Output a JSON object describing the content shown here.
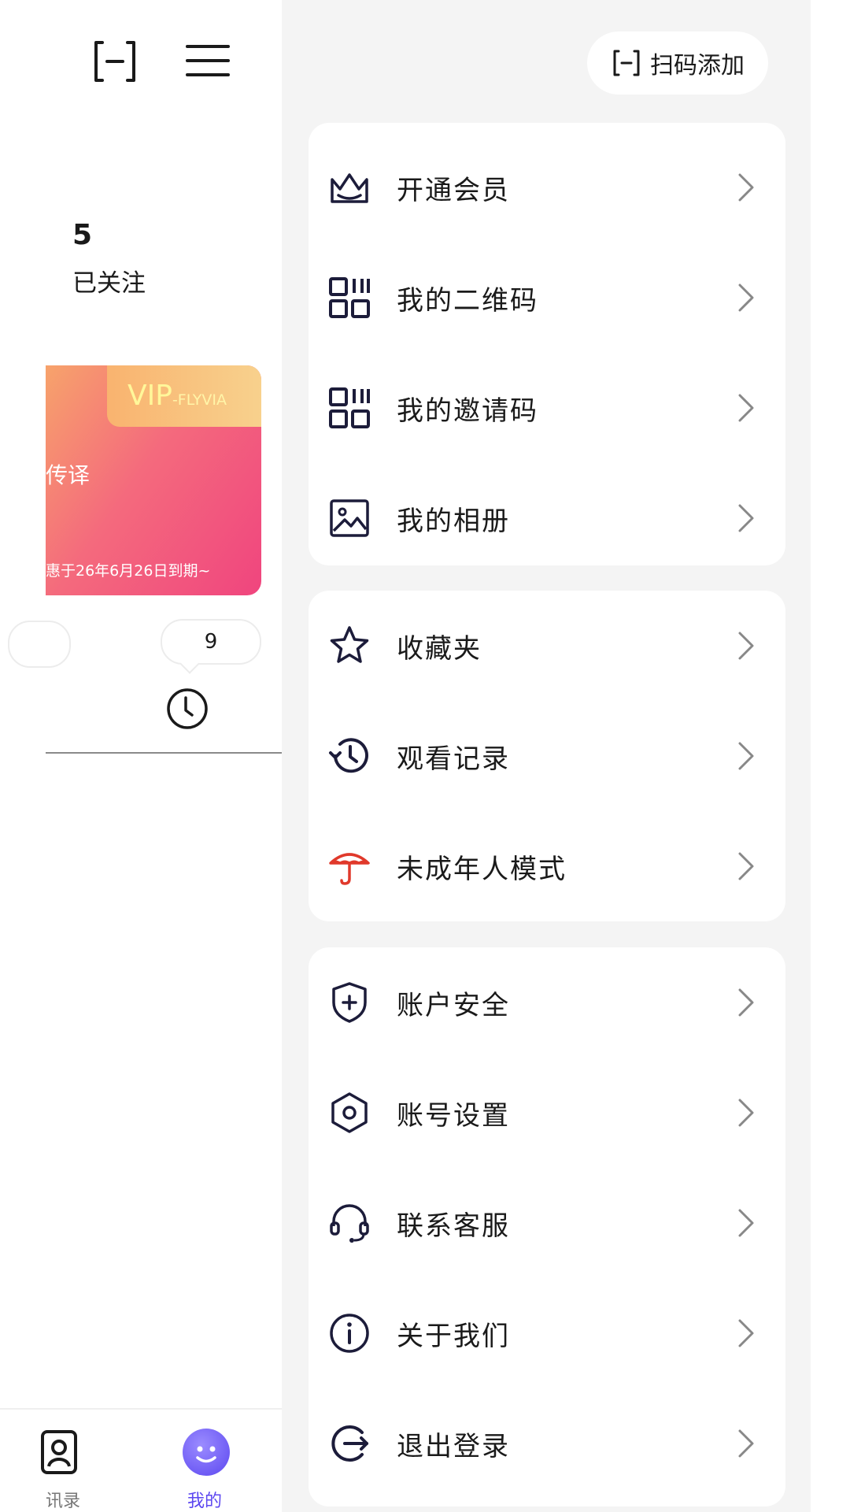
{
  "left_panel": {
    "stat_number": "5",
    "stat_label": "已关注",
    "vip_card": {
      "badge_main": "VIP",
      "badge_sub": "-FLYVIA",
      "title_fragment": "传译",
      "expire_text": "惠于26年6月26日到期~"
    },
    "history_count": "9",
    "tabbar": {
      "contacts_label": "讯录",
      "me_label": "我的"
    }
  },
  "drawer": {
    "scan_add_label": "扫码添加",
    "groups": [
      [
        {
          "label": "开通会员",
          "icon": "crown-icon"
        },
        {
          "label": "我的二维码",
          "icon": "qrcode-icon"
        },
        {
          "label": "我的邀请码",
          "icon": "invite-code-icon"
        },
        {
          "label": "我的相册",
          "icon": "album-icon"
        }
      ],
      [
        {
          "label": "收藏夹",
          "icon": "star-icon"
        },
        {
          "label": "观看记录",
          "icon": "history-icon"
        },
        {
          "label": "未成年人模式",
          "icon": "umbrella-icon"
        }
      ],
      [
        {
          "label": "账户安全",
          "icon": "shield-icon"
        },
        {
          "label": "账号设置",
          "icon": "settings-hex-icon"
        },
        {
          "label": "联系客服",
          "icon": "headset-icon"
        },
        {
          "label": "关于我们",
          "icon": "info-icon"
        },
        {
          "label": "退出登录",
          "icon": "logout-icon"
        }
      ]
    ]
  },
  "colors": {
    "accent": "#5c47f0",
    "icon_dark": "#1c1c3a",
    "umbrella_red": "#e0392b",
    "drawer_bg": "#f4f4f4"
  }
}
